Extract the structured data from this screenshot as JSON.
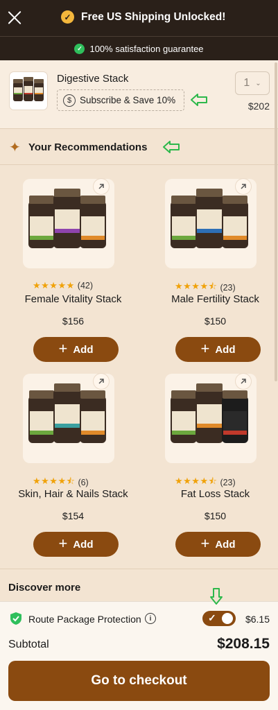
{
  "header": {
    "shipping_text": "Free US Shipping Unlocked!",
    "guarantee_text": "100% satisfaction guarantee"
  },
  "cart_item": {
    "title": "Digestive Stack",
    "subscribe_label": "Subscribe & Save 10%",
    "quantity": "1",
    "price": "$202"
  },
  "recommendations": {
    "title": "Your Recommendations",
    "add_label": "Add",
    "products": [
      {
        "name": "Female Vitality Stack",
        "price": "$156",
        "rating": 5,
        "reviews": "(42)",
        "labels": [
          "BONE LIVER",
          "HER PACKAGE",
          "FIRE STARTER"
        ]
      },
      {
        "name": "Male Fertility Stack",
        "price": "$150",
        "rating": 4.5,
        "reviews": "(23)",
        "labels": [
          "BONE LIVER",
          "WHOLE PACKAGE",
          "FIRE STARTER"
        ]
      },
      {
        "name": "Skin, Hair & Nails Stack",
        "price": "$154",
        "rating": 4.5,
        "reviews": "(6)",
        "labels": [
          "GUT & DIGESTION",
          "SKIN NAILS",
          "FIRE STARTER"
        ]
      },
      {
        "name": "Fat Loss Stack",
        "price": "$150",
        "rating": 4.5,
        "reviews": "(23)",
        "labels": [
          "GUT & DIGESTION",
          "FIRE STARTER",
          "WARRIOR"
        ]
      }
    ]
  },
  "discover": {
    "title": "Discover more"
  },
  "footer": {
    "route_label": "Route Package Protection",
    "route_price": "$6.15",
    "route_enabled": true,
    "subtotal_label": "Subtotal",
    "subtotal_value": "$208.15",
    "checkout_label": "Go to checkout"
  },
  "colors": {
    "accent": "#8a4a10",
    "dark_header": "#2a2019",
    "star": "#f0a20a",
    "check_green": "#2fbf5c",
    "annotation_arrow": "#2db84b"
  },
  "icons": [
    "close-icon",
    "check-circle-icon",
    "dollar-circle-icon",
    "chevron-down-icon",
    "sparkle-icon",
    "external-link-icon",
    "plus-icon",
    "shield-check-icon",
    "info-icon",
    "check-icon"
  ]
}
